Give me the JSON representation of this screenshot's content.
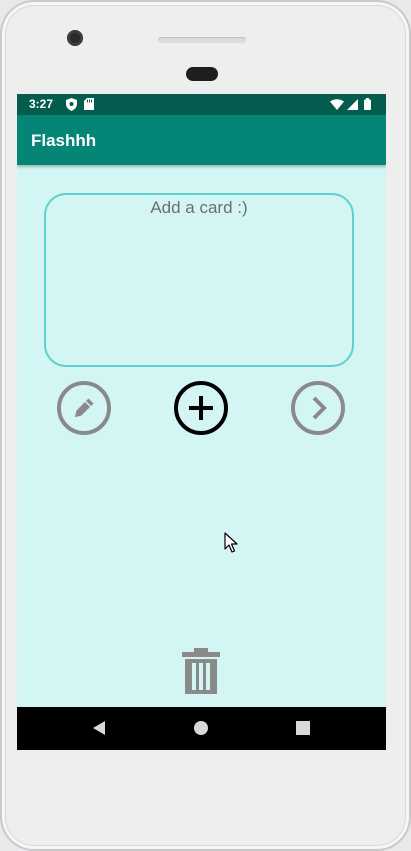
{
  "status_bar": {
    "time": "3:27",
    "icons": [
      "shield-icon",
      "sd-card-icon",
      "wifi-icon",
      "signal-icon",
      "battery-icon"
    ]
  },
  "app_bar": {
    "title": "Flashhh"
  },
  "card": {
    "text": "Add a card :)"
  },
  "actions": {
    "edit_icon": "pencil-icon",
    "add_icon": "plus-circle-icon",
    "next_icon": "chevron-right-icon",
    "delete_icon": "trash-icon"
  },
  "nav_bar": {
    "icons": [
      "back-icon",
      "home-icon",
      "recents-icon"
    ]
  },
  "colors": {
    "status_bar": "#045c4f",
    "app_bar": "#058576",
    "screen_bg": "#d3f6f4",
    "card_border": "#5dd0cf",
    "inactive_icon": "#8a8a8a",
    "active_icon": "#000000"
  }
}
